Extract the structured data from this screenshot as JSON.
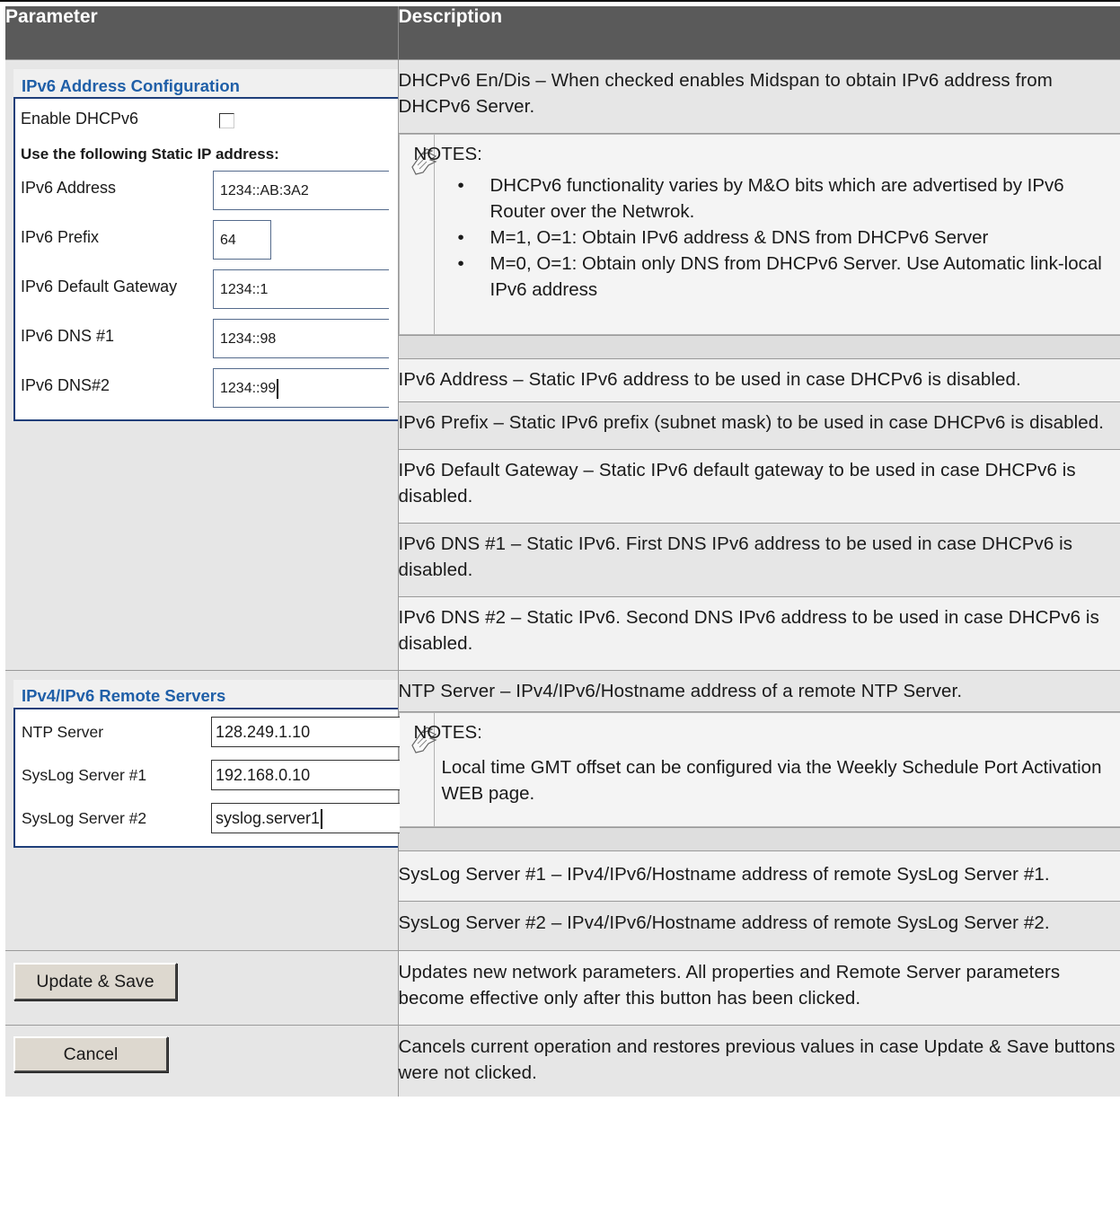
{
  "table": {
    "header": {
      "parameter": "Parameter",
      "description": "Description"
    }
  },
  "ipv6_panel": {
    "title": "IPv6 Address Configuration",
    "enable_label": "Enable DHCPv6",
    "enable_checked": false,
    "static_heading": "Use the following Static IP address:",
    "fields": [
      {
        "label": "IPv6 Address",
        "value": "1234::AB:3A2"
      },
      {
        "label": "IPv6 Prefix",
        "value": "64"
      },
      {
        "label": "IPv6 Default Gateway",
        "value": "1234::1"
      },
      {
        "label": "IPv6 DNS #1",
        "value": "1234::98"
      },
      {
        "label": "IPv6 DNS#2",
        "value": "1234::99"
      }
    ]
  },
  "remote_panel": {
    "title": "IPv4/IPv6 Remote Servers",
    "fields": [
      {
        "label": "NTP Server",
        "value": "128.249.1.10"
      },
      {
        "label": "SysLog Server #1",
        "value": "192.168.0.10"
      },
      {
        "label": "SysLog Server #2",
        "value": "syslog.server1"
      }
    ]
  },
  "buttons": {
    "update_save": "Update & Save",
    "cancel": "Cancel"
  },
  "descriptions": {
    "dhcpv6": "DHCPv6 En/Dis – When checked enables Midspan to obtain IPv6 address from DHCPv6 Server.",
    "notes1": {
      "title": "NOTES:",
      "items": [
        "DHCPv6 functionality varies by M&O bits which are advertised by IPv6 Router over the Netwrok.",
        "M=1, O=1: Obtain IPv6 address & DNS from DHCPv6 Server",
        "M=0, O=1: Obtain only DNS from DHCPv6 Server. Use Automatic link-local IPv6 address"
      ]
    },
    "ipv6_address": "IPv6 Address – Static IPv6 address to be used in case DHCPv6 is disabled.",
    "ipv6_prefix": "IPv6 Prefix – Static IPv6 prefix (subnet mask) to be used in case DHCPv6 is disabled.",
    "ipv6_gateway": "IPv6 Default Gateway – Static IPv6 default gateway to be used in case DHCPv6 is disabled.",
    "ipv6_dns1": "IPv6 DNS #1 – Static IPv6. First DNS IPv6 address to be used in case DHCPv6 is disabled.",
    "ipv6_dns2": "IPv6 DNS #2 – Static IPv6. Second DNS IPv6 address to be used in case DHCPv6 is disabled.",
    "ntp": "NTP Server – IPv4/IPv6/Hostname address of a remote NTP Server.",
    "notes2": {
      "title": "NOTES:",
      "text": "Local time GMT offset can be configured via the Weekly Schedule Port Activation WEB page."
    },
    "syslog1": "SysLog Server #1 – IPv4/IPv6/Hostname address of remote SysLog Server #1.",
    "syslog2": "SysLog Server #2 – IPv4/IPv6/Hostname address of remote SysLog Server #2.",
    "update_save": "Updates new network parameters. All properties and Remote Server parameters become effective only after this button has been clicked.",
    "cancel": "Cancels current operation and restores previous values in case Update & Save buttons were not clicked."
  },
  "icons": {
    "note": "note-hand-icon"
  },
  "colors": {
    "header_bg": "#5a5a5a",
    "panel_title": "#1f5fa8",
    "panel_border": "#1f3f7a"
  }
}
